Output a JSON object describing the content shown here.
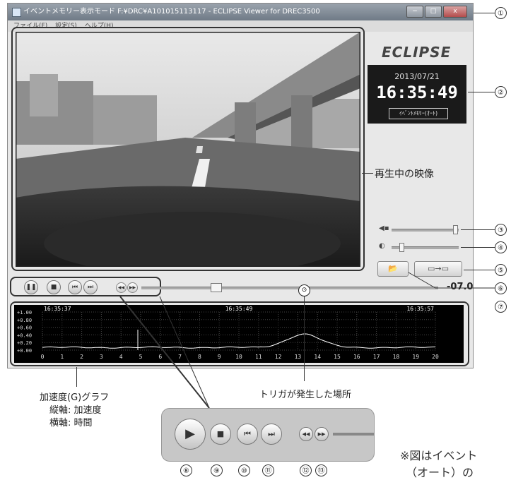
{
  "window": {
    "title": "イベントメモリー表示モード F:¥DRC¥A101015113117 - ECLIPSE Viewer for DREC3500",
    "minimize_label": "−",
    "maximize_label": "□",
    "close_label": "x"
  },
  "menu": {
    "items": [
      "ファイル(F)",
      "設定(S)",
      "ヘルプ(H)"
    ]
  },
  "brand": {
    "logo_text": "ECLIPSE"
  },
  "clock": {
    "date": "2013/07/21",
    "time": "16:35:49",
    "mode_label": "ｲﾍﾞﾝﾄﾒﾓﾘｰ(ｵｰﾄ)"
  },
  "volume": {
    "icon": "speaker-icon",
    "level": 0.95
  },
  "brightness": {
    "icon": "brightness-icon",
    "level": 0.15
  },
  "playback": {
    "position": 0.24,
    "offset_label": "-07.0"
  },
  "graph": {
    "y_ticks": [
      "+1.00",
      "+0.80",
      "+0.60",
      "+0.40",
      "+0.20",
      "+0.00"
    ],
    "x_ticks": [
      "0",
      "1",
      "2",
      "3",
      "4",
      "5",
      "6",
      "7",
      "8",
      "9",
      "10",
      "11",
      "12",
      "13",
      "14",
      "15",
      "16",
      "17",
      "18",
      "19",
      "20"
    ],
    "time_left": "16:35:37",
    "time_mid": "16:35:49",
    "time_right": "16:35:57"
  },
  "annotations": {
    "video_label": "再生中の映像",
    "graph_label_1": "加速度(G)グラフ",
    "graph_label_2": "縦軸: 加速度",
    "graph_label_3": "横軸: 時間",
    "trigger_label": "トリガが発生した場所",
    "note_text": "※図はイベント",
    "note_text_2": "（オート）の",
    "callouts": [
      "①",
      "②",
      "③",
      "④",
      "⑤",
      "⑥",
      "⑦",
      "⑧",
      "⑨",
      "⑩",
      "⑪",
      "⑫",
      "⑬"
    ]
  },
  "colors": {
    "window_bg": "#e8e8e8",
    "clock_bg": "#1a1a1a",
    "graph_bg": "#000000",
    "graph_line": "#ffffff"
  }
}
